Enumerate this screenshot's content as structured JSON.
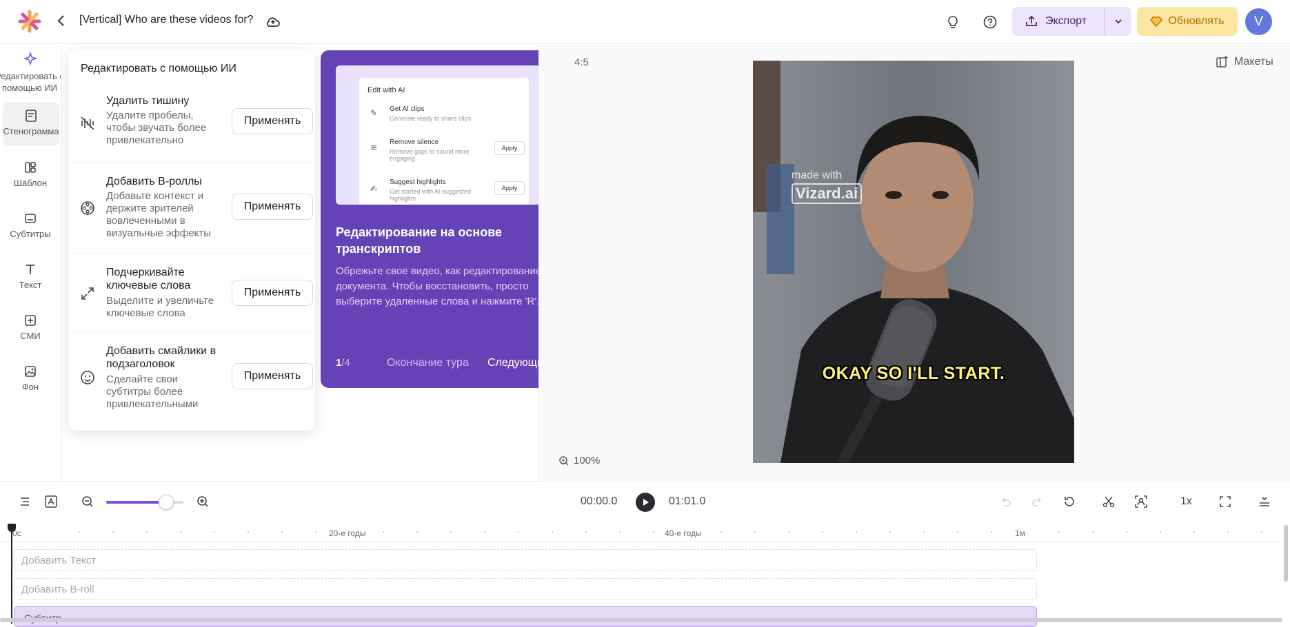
{
  "header": {
    "project_title": "[Vertical] Who are these videos for?",
    "export_label": "Экспорт",
    "upgrade_label": "Обновлять",
    "avatar_initial": "V",
    "accent": "#7c4fe0"
  },
  "sidebar": {
    "items": [
      {
        "label": "Редактировать с помощью ИИ",
        "icon": "sparkle-icon"
      },
      {
        "label": "Стенограмма",
        "icon": "transcript-icon"
      },
      {
        "label": "Шаблон",
        "icon": "template-icon"
      },
      {
        "label": "Субтитры",
        "icon": "subtitles-icon"
      },
      {
        "label": "Текст",
        "icon": "text-icon"
      },
      {
        "label": "СМИ",
        "icon": "media-icon"
      },
      {
        "label": "Фон",
        "icon": "background-icon"
      }
    ]
  },
  "ai_panel": {
    "title": "Редактировать с помощью ИИ",
    "apply_label": "Применять",
    "items": [
      {
        "name": "Удалить тишину",
        "desc": "Удалите пробелы, чтобы звучать более привлекательно",
        "icon": "remove-silence-icon"
      },
      {
        "name": "Добавить B-роллы",
        "desc": "Добавьте контекст и держите зрителей вовлеченными в визуальные эффекты",
        "icon": "broll-icon"
      },
      {
        "name": "Подчеркивайте ключевые слова",
        "desc": "Выделите и увеличьте ключевые слова",
        "icon": "expand-icon"
      },
      {
        "name": "Добавить смайлики в подзаголовок",
        "desc": "Сделайте свои субтитры более привлекательными",
        "icon": "emoji-icon"
      }
    ]
  },
  "tour": {
    "preview": {
      "header": "Edit with AI",
      "rows": [
        {
          "title": "Get AI clips",
          "sub": "Generate ready to share clips",
          "apply": ""
        },
        {
          "title": "Remove silence",
          "sub": "Remove gaps to sound more engaging",
          "apply": "Apply"
        },
        {
          "title": "Suggest highlights",
          "sub": "Get started with AI-suggested highlights",
          "apply": "Apply"
        }
      ]
    },
    "title": "Редактирование на основе транскриптов",
    "body": "Обрежьте свое видео, как редактирование документа. Чтобы восстановить, просто выберите удаленные слова и нажмите 'R'.",
    "step_current": "1",
    "step_total": "/4",
    "end_label": "Окончание тура",
    "next_label": "Следующий"
  },
  "preview": {
    "aspect_ratio": "4:5",
    "layouts_label": "Макеты",
    "zoom_label": "100%",
    "watermark_top": "made with",
    "watermark_brand": "Vizard.ai",
    "caption": "OKAY SO I'LL START."
  },
  "timeline": {
    "current_time": "00:00.0",
    "duration": "01:01.0",
    "speed": "1x",
    "zoom_fraction": 0.78,
    "ruler_labels": [
      "0с",
      "20-е годы",
      "40-е годы",
      "1м"
    ],
    "tracks": {
      "text": "Добавить Текст",
      "broll": "Добавить B-roll",
      "subtitle": "Субтитр"
    }
  }
}
